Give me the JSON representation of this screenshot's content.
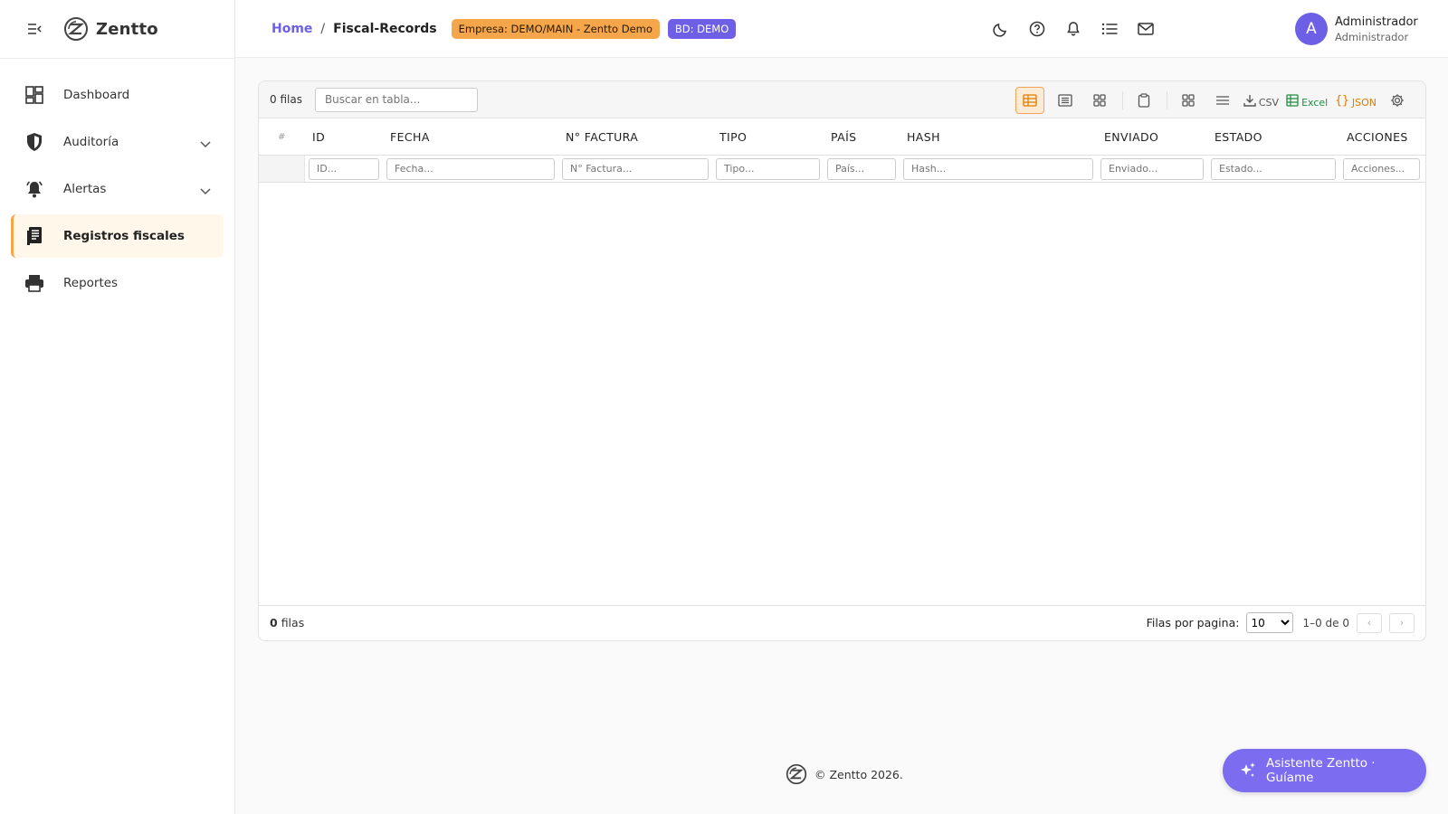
{
  "app": {
    "name": "Zentto"
  },
  "sidebar": {
    "items": [
      {
        "label": "Dashboard",
        "icon": "dashboard-icon",
        "expandable": false,
        "active": false
      },
      {
        "label": "Auditoría",
        "icon": "shield-icon",
        "expandable": true,
        "active": false
      },
      {
        "label": "Alertas",
        "icon": "bell-ring-icon",
        "expandable": true,
        "active": false
      },
      {
        "label": "Registros fiscales",
        "icon": "receipt-icon",
        "expandable": false,
        "active": true
      },
      {
        "label": "Reportes",
        "icon": "printer-icon",
        "expandable": false,
        "active": false
      }
    ]
  },
  "header": {
    "breadcrumb": {
      "home": "Home",
      "separator": "/",
      "current": "Fiscal-Records"
    },
    "company_badge": "Empresa: DEMO/MAIN - Zentto Demo",
    "db_badge": "BD: DEMO",
    "icons": [
      "moon-icon",
      "help-icon",
      "bell-icon",
      "list-icon",
      "mail-icon"
    ],
    "user": {
      "initial": "A",
      "name": "Administrador",
      "role": "Administrador"
    }
  },
  "table": {
    "rows_count": "0 filas",
    "search_placeholder": "Buscar en tabla...",
    "toolbar": {
      "csv_label": "CSV",
      "excel_label": "Excel",
      "json_label": "JSON"
    },
    "row_number_header": "#",
    "columns": [
      {
        "label": "ID",
        "filter": "ID..."
      },
      {
        "label": "FECHA",
        "filter": "Fecha..."
      },
      {
        "label": "N° FACTURA",
        "filter": "N° Factura..."
      },
      {
        "label": "TIPO",
        "filter": "Tipo..."
      },
      {
        "label": "PAÍS",
        "filter": "País..."
      },
      {
        "label": "HASH",
        "filter": "Hash..."
      },
      {
        "label": "ENVIADO",
        "filter": "Enviado..."
      },
      {
        "label": "ESTADO",
        "filter": "Estado..."
      },
      {
        "label": "ACCIONES",
        "filter": "Acciones..."
      }
    ],
    "footer": {
      "count": "0",
      "count_suffix": "filas",
      "per_page_label": "Filas por pagina:",
      "per_page_value": "10",
      "range": "1–0 de 0",
      "prev": "‹",
      "next": "›"
    }
  },
  "page_footer": {
    "text": "© Zentto 2026."
  },
  "assistant": {
    "label": "Asistente Zentto · Guíame"
  },
  "colors": {
    "accent": "#6d5fe6",
    "warning": "#f5a54a",
    "excel": "#1e8e3e",
    "json": "#e07b00"
  }
}
